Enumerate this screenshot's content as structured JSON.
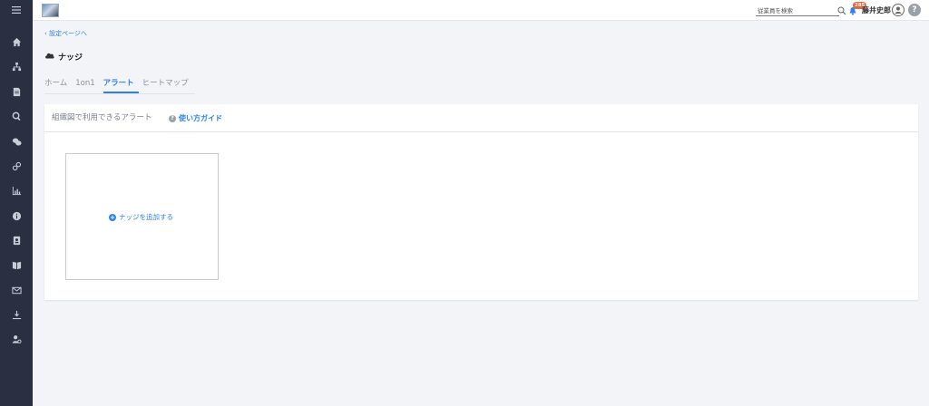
{
  "header": {
    "search_placeholder": "従業員を検索",
    "notification_count": "285",
    "username": "藤井史郎",
    "help_label": "?"
  },
  "sidebar": {
    "items": [
      {
        "icon": "home-icon"
      },
      {
        "icon": "org-chart-icon"
      },
      {
        "icon": "document-icon"
      },
      {
        "icon": "search-icon"
      },
      {
        "icon": "chat-icon"
      },
      {
        "icon": "link-icon"
      },
      {
        "icon": "chart-icon"
      },
      {
        "icon": "info-icon"
      },
      {
        "icon": "contact-icon"
      },
      {
        "icon": "book-icon"
      },
      {
        "icon": "mail-icon"
      },
      {
        "icon": "download-icon"
      },
      {
        "icon": "user-settings-icon"
      }
    ]
  },
  "breadcrumb": {
    "back_label": "設定ページへ"
  },
  "page": {
    "title": "ナッジ"
  },
  "tabs": [
    {
      "label": "ホーム",
      "active": false
    },
    {
      "label": "1on1",
      "active": false
    },
    {
      "label": "アラート",
      "active": true
    },
    {
      "label": "ヒートマップ",
      "active": false
    }
  ],
  "card": {
    "header_label": "組織図で利用できるアラート",
    "guide_label": "使い方ガイド",
    "add_label": "ナッジを追加する"
  },
  "colors": {
    "sidebar_bg": "#2a2f42",
    "accent": "#2f80ed",
    "badge": "#e8643a",
    "page_bg": "#f3f4f8"
  }
}
